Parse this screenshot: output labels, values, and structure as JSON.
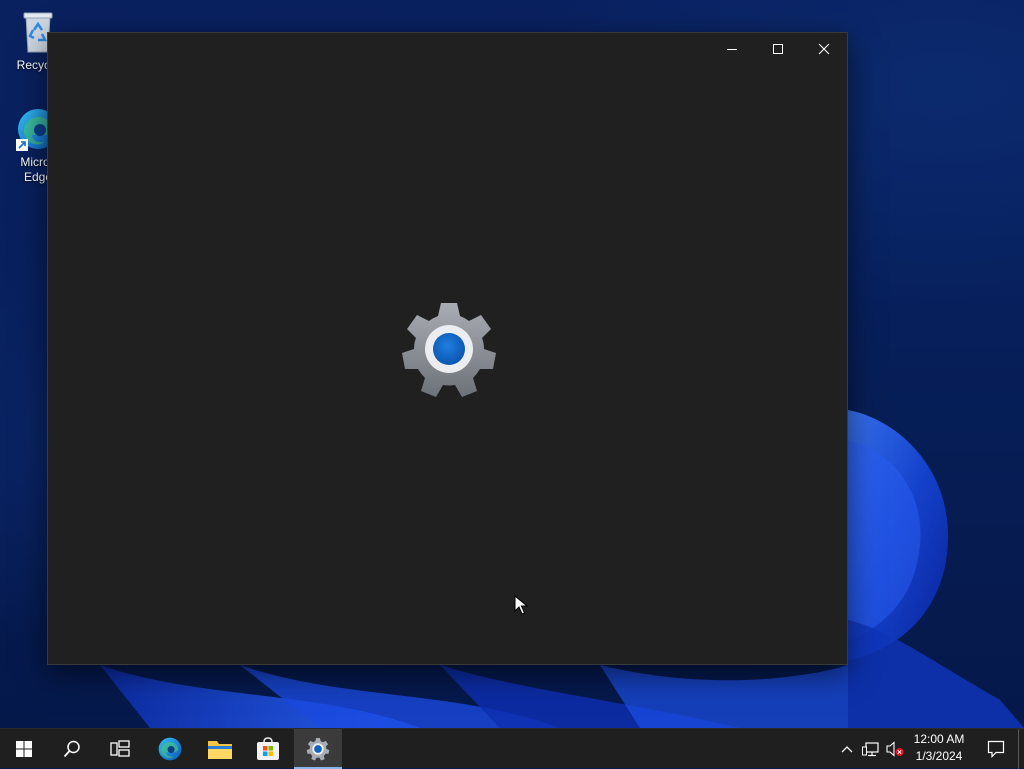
{
  "desktop": {
    "icons": [
      {
        "label": "Recycle",
        "icon": "recycle-bin-icon"
      },
      {
        "label": "Micros",
        "label2": "Edge",
        "icon": "edge-icon"
      }
    ]
  },
  "window": {
    "title": "",
    "controls": {
      "minimize": "minimize-icon",
      "maximize": "maximize-icon",
      "close": "close-icon"
    },
    "splash_icon": "settings-gear-icon"
  },
  "taskbar": {
    "buttons": [
      {
        "name": "start",
        "icon": "windows-logo-icon"
      },
      {
        "name": "search",
        "icon": "search-icon"
      },
      {
        "name": "task-view",
        "icon": "task-view-icon"
      },
      {
        "name": "edge",
        "icon": "edge-icon"
      },
      {
        "name": "file-explorer",
        "icon": "folder-icon"
      },
      {
        "name": "store",
        "icon": "store-icon"
      },
      {
        "name": "settings",
        "icon": "settings-gear-icon",
        "active": true
      }
    ],
    "tray": {
      "chevron": "chevron-up-icon",
      "network": "network-icon",
      "volume": "volume-muted-icon"
    },
    "clock": {
      "time": "12:00 AM",
      "date": "1/3/2024"
    },
    "notifications": "notification-icon"
  },
  "colors": {
    "window_bg": "#202020",
    "taskbar_bg": "#1f1f1f",
    "accent": "#0f62c0",
    "active_indicator": "#8cb4e8"
  }
}
